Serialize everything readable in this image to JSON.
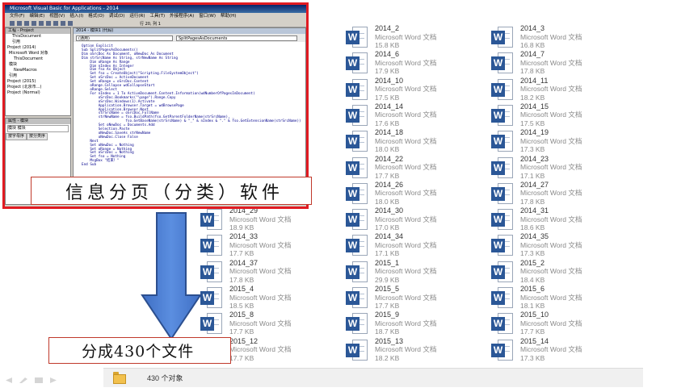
{
  "vba_editor": {
    "title": "Microsoft Visual Basic for Applications - 2014",
    "menu": [
      "文件(F)",
      "编辑(E)",
      "视图(V)",
      "插入(I)",
      "格式(O)",
      "调试(D)",
      "运行(R)",
      "工具(T)",
      "外接程序(A)",
      "窗口(W)",
      "帮助(H)"
    ],
    "cursor_position": "行 20, 列 1",
    "project_pane_title": "工程 - Project",
    "project_tree": [
      "ThisDocument",
      "引用",
      "Project (2014)",
      "Microsoft Word 对象",
      "ThisDocument",
      "模块",
      "NewMacros",
      "引用",
      "Project (2015)",
      "Project (北京市...)",
      "Project (Normal)"
    ],
    "properties_pane_title": "属性 - 模块",
    "properties_selector": "模块 模块",
    "properties_tabs": [
      "按字母序",
      "按分类序"
    ],
    "code_window_title": "2014 - 模块1 (代码)",
    "code_object_combo": "(通用)",
    "code_proc_combo": "SplitPagesAsDocuments",
    "code_lines": [
      "Option Explicit",
      "Sub SplitPagesAsDocuments()",
      "Dim oSrcDoc As Document, oNewDoc As Document",
      "Dim strSrcName As String, strNewName As String",
      "    Dim oRange As Range",
      "    Dim nIndex As Integer",
      "    Dim fso As Object",
      "",
      "    Set fso = CreateObject(\"Scripting.FileSystemObject\")",
      "    Set oSrcDoc = ActiveDocument",
      "    Set oRange = oSrcDoc.Content",
      "    oRange.Collapse wdCollapseStart",
      "    oRange.Select",
      "    For nIndex = 1 To ActiveDocument.Content.Information(wdNumberOfPagesInDocument)",
      "        oSrcDoc.Bookmarks(\"\\page\").Range.Copy",
      "        oSrcDoc.Windows(1).Activate",
      "        Application.Browser.Target = wdBrowsePage",
      "        Application.Browser.Next",
      "",
      "        strSrcName = oSrcDoc.FullName",
      "        strNewName = fso.BuildPath(fso.GetParentFolderName(strSrcName), _",
      "                     fso.GetBaseName(strSrcName) & \"_\" & nIndex & \".\" & fso.GetExtensionName(strSrcName))",
      "        Set oNewDoc = Documents.Add",
      "        Selection.Paste",
      "        oNewDoc.SaveAs strNewName",
      "        oNewDoc.Close False",
      "    Next",
      "    Set oNewDoc = Nothing",
      "    Set oRange = Nothing",
      "    Set oSrcDoc = Nothing",
      "    Set fso = Nothing",
      "    MsgBox \"结束！\"",
      "End Sub"
    ]
  },
  "overlay_labels": {
    "top": "信息分页（分类）软件",
    "bottom": "分成430个文件"
  },
  "files": {
    "type_label": "Microsoft Word 文档",
    "items": [
      {
        "name": "2014_2",
        "size": "15.8 KB"
      },
      {
        "name": "2014_3",
        "size": "16.8 KB"
      },
      {
        "name": "2014_6",
        "size": "17.9 KB"
      },
      {
        "name": "2014_7",
        "size": "17.8 KB"
      },
      {
        "name": "2014_10",
        "size": "17.5 KB"
      },
      {
        "name": "2014_11",
        "size": "18.2 KB"
      },
      {
        "name": "2014_14",
        "size": "17.6 KB"
      },
      {
        "name": "2014_15",
        "size": "17.5 KB"
      },
      {
        "name": "2014_18",
        "size": "18.0 KB"
      },
      {
        "name": "2014_19",
        "size": "17.3 KB"
      },
      {
        "name": "2014_22",
        "size": "17.7 KB"
      },
      {
        "name": "2014_23",
        "size": "17.1 KB"
      },
      {
        "name": "2014_26",
        "size": "18.0 KB"
      },
      {
        "name": "2014_27",
        "size": "17.8 KB"
      },
      {
        "name": "2014_29",
        "size": "18.9 KB"
      },
      {
        "name": "2014_30",
        "size": "17.0 KB"
      },
      {
        "name": "2014_31",
        "size": "18.6 KB"
      },
      {
        "name": "2014_33",
        "size": "17.7 KB"
      },
      {
        "name": "2014_34",
        "size": "17.1 KB"
      },
      {
        "name": "2014_35",
        "size": "17.3 KB"
      },
      {
        "name": "2014_37",
        "size": "17.8 KB"
      },
      {
        "name": "2015_1",
        "size": "29.9 KB"
      },
      {
        "name": "2015_2",
        "size": "18.4 KB"
      },
      {
        "name": "2015_4",
        "size": "18.5 KB"
      },
      {
        "name": "2015_5",
        "size": "17.7 KB"
      },
      {
        "name": "2015_6",
        "size": "18.1 KB"
      },
      {
        "name": "2015_8",
        "size": "17.7 KB"
      },
      {
        "name": "2015_9",
        "size": "18.7 KB"
      },
      {
        "name": "2015_10",
        "size": "17.7 KB"
      },
      {
        "name": "2015_12",
        "size": "17.7 KB"
      },
      {
        "name": "2015_13",
        "size": "18.2 KB"
      },
      {
        "name": "2015_14",
        "size": "17.3 KB"
      }
    ]
  },
  "status_bar": {
    "item_count": "430 个对象"
  },
  "colors": {
    "word_badge": "#2b5797",
    "highlight_border": "#e11b22",
    "arrow_fill": "#4a7bd0"
  }
}
